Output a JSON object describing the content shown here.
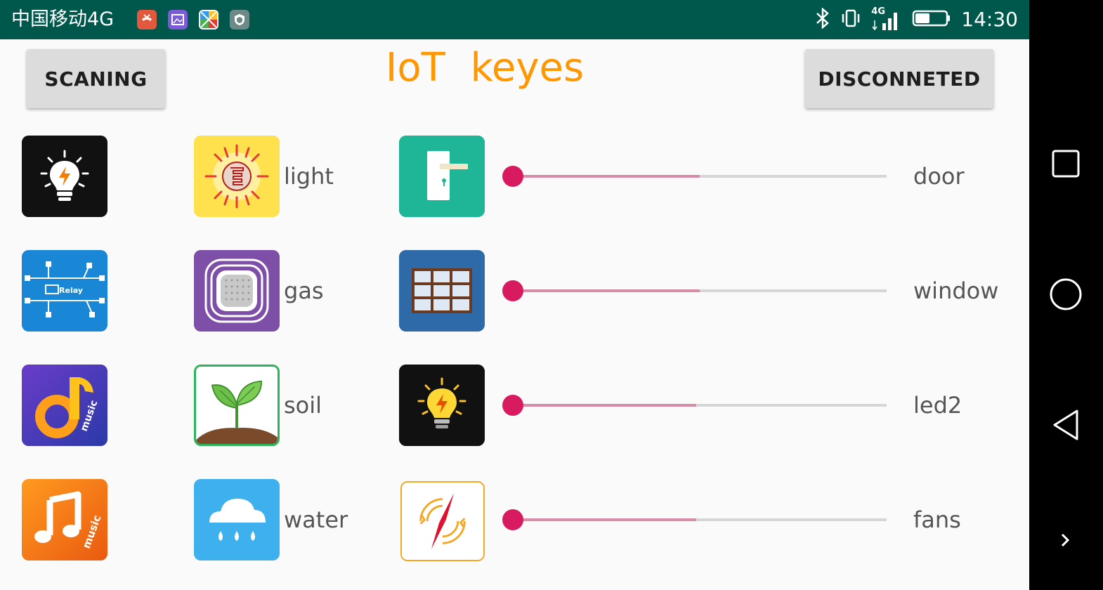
{
  "status_bar": {
    "carrier": "中国移动4G",
    "network_badge": "4G",
    "time": "14:30",
    "notification_icons": [
      "missed-call-icon",
      "gallery-icon",
      "play-store-icon",
      "security-icon"
    ],
    "right_icons": [
      "bluetooth-icon",
      "vibrate-icon",
      "signal-icon",
      "battery-icon"
    ]
  },
  "header": {
    "scan_button": "SCANING",
    "title": "IoT  keyes",
    "disconnect_button": "DISCONNETED"
  },
  "left_buttons": [
    {
      "icon": "bulb-icon",
      "color": "#111111"
    },
    {
      "icon": "relay-icon",
      "color": "#1a86d6",
      "text": "Relay"
    },
    {
      "icon": "music-note-icon",
      "color": "#3b3fb6",
      "text": "music"
    },
    {
      "icon": "music-icon",
      "color": "#f06b14",
      "text": "music"
    }
  ],
  "sensors": [
    {
      "label": "light",
      "icon": "light-sensor-icon",
      "color": "#ffe14d"
    },
    {
      "label": "gas",
      "icon": "gas-sensor-icon",
      "color": "#7e4fa6"
    },
    {
      "label": "soil",
      "icon": "soil-sensor-icon",
      "color": "#ffffff"
    },
    {
      "label": "water",
      "icon": "water-sensor-icon",
      "color": "#3fb0ee"
    }
  ],
  "devices": [
    {
      "label": "door",
      "icon": "door-icon",
      "color": "#1fb597",
      "value_percent": 50
    },
    {
      "label": "window",
      "icon": "window-icon",
      "color": "#2f6aa8",
      "value_percent": 50
    },
    {
      "label": "led2",
      "icon": "led-bulb-icon",
      "color": "#111111",
      "value_percent": 49
    },
    {
      "label": "fans",
      "icon": "fan-icon",
      "color": "#ffffff",
      "value_percent": 49
    }
  ],
  "accent_color": "#ff9800",
  "slider_color": "#d81b60"
}
